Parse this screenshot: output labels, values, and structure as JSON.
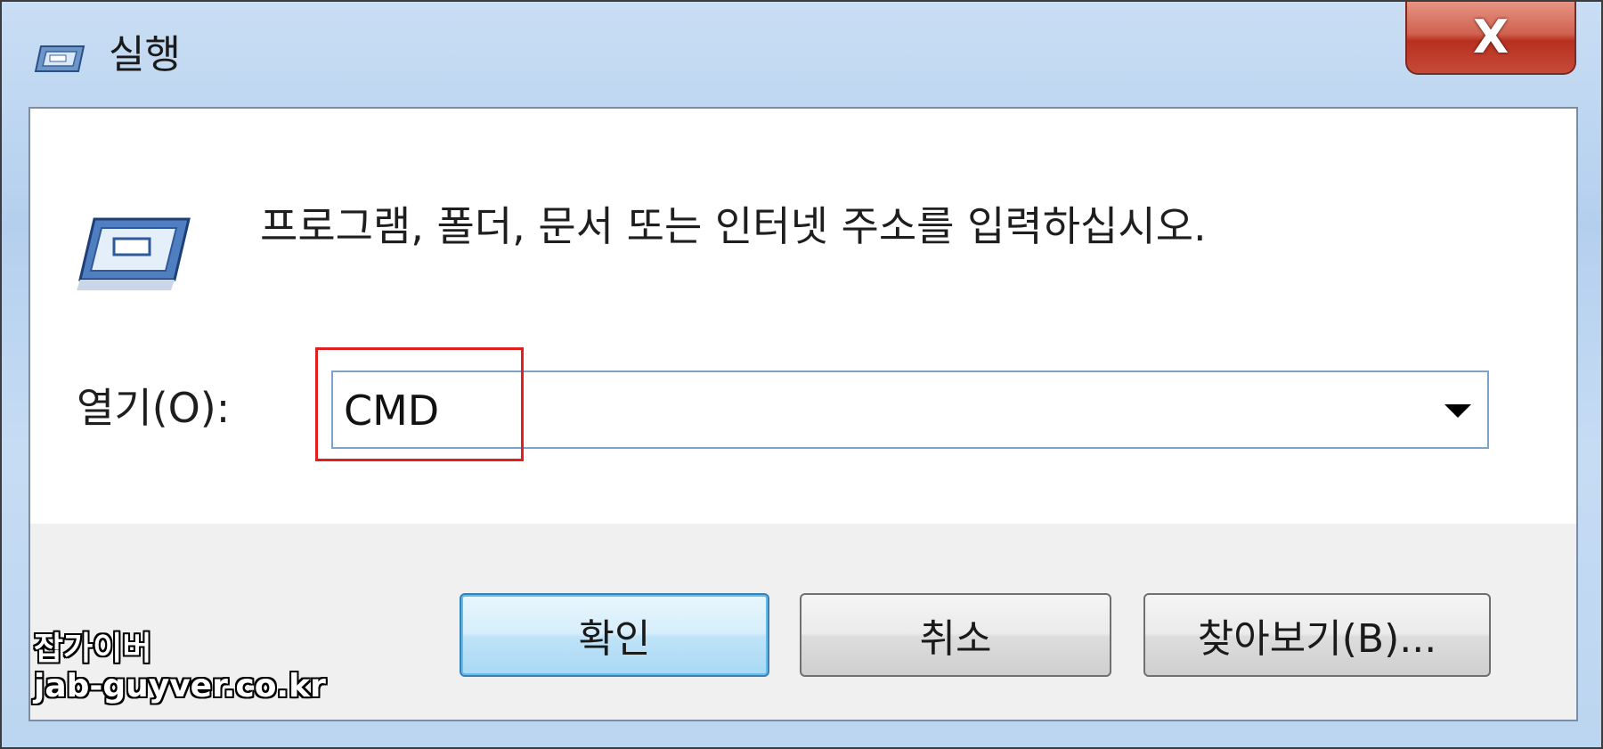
{
  "window": {
    "title": "실행",
    "close_label": "X"
  },
  "main": {
    "prompt": "프로그램, 폴더, 문서 또는 인터넷 주소를 입력하십시오.",
    "open_label": "열기(O):",
    "open_value": "CMD"
  },
  "buttons": {
    "ok": "확인",
    "cancel": "취소",
    "browse": "찾아보기(B)..."
  },
  "watermark": {
    "line1": "잡가이버",
    "line2": "jab-guyver.co.kr"
  },
  "icons": {
    "title": "run-icon",
    "main": "run-icon",
    "dropdown": "chevron-down-icon"
  },
  "colors": {
    "highlight": "#e02020",
    "title_bar": "#bcd5f0",
    "close_button": "#c54a38",
    "ok_button": "#bfe3f8"
  }
}
